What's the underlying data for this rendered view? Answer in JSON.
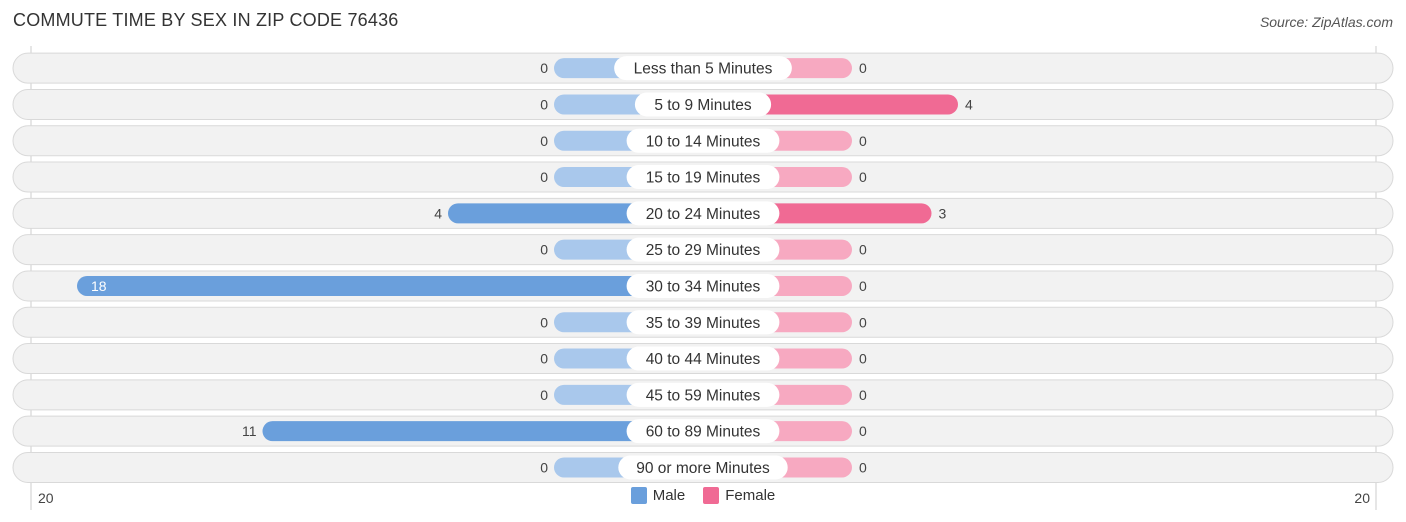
{
  "header": {
    "title": "COMMUTE TIME BY SEX IN ZIP CODE 76436",
    "source": "Source: ZipAtlas.com"
  },
  "legend": {
    "male_label": "Male",
    "female_label": "Female"
  },
  "colors": {
    "male_strong": "#6a9fdc",
    "male_light": "#a9c8ec",
    "female_strong": "#f06a94",
    "female_light": "#f7a9c1",
    "row_bg": "#f2f2f2",
    "row_border": "#d9d9d9"
  },
  "chart_data": {
    "type": "bar",
    "orientation": "horizontal-diverging",
    "title": "COMMUTE TIME BY SEX IN ZIP CODE 76436",
    "categories": [
      "Less than 5 Minutes",
      "5 to 9 Minutes",
      "10 to 14 Minutes",
      "15 to 19 Minutes",
      "20 to 24 Minutes",
      "25 to 29 Minutes",
      "30 to 34 Minutes",
      "35 to 39 Minutes",
      "40 to 44 Minutes",
      "45 to 59 Minutes",
      "60 to 89 Minutes",
      "90 or more Minutes"
    ],
    "series": [
      {
        "name": "Male",
        "values": [
          0,
          0,
          0,
          0,
          4,
          0,
          18,
          0,
          0,
          0,
          11,
          0
        ]
      },
      {
        "name": "Female",
        "values": [
          0,
          4,
          0,
          0,
          3,
          0,
          0,
          0,
          0,
          0,
          0,
          0
        ]
      }
    ],
    "axis": {
      "left_label": "20",
      "right_label": "20",
      "max": 20
    },
    "legend_position": "bottom-center"
  }
}
